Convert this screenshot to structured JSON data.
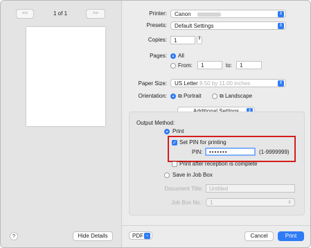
{
  "preview": {
    "page_counter": "1 of 1",
    "prev_label": "<<",
    "prev_single_label": "<",
    "next_single_label": ">",
    "next_label": ">>",
    "help_label": "?",
    "hide_details_label": "Hide Details"
  },
  "printer": {
    "label": "Printer:",
    "value": "Canon"
  },
  "presets": {
    "label": "Presets:",
    "value": "Default Settings"
  },
  "copies": {
    "label": "Copies:",
    "value": "1"
  },
  "pages": {
    "label": "Pages:",
    "all_label": "All",
    "from_label": "From:",
    "from_value": "1",
    "to_label": "to:",
    "to_value": "1"
  },
  "paper_size": {
    "label": "Paper Size:",
    "value": "US Letter",
    "detail": "8.50 by 11.00 inches"
  },
  "orientation": {
    "label": "Orientation:",
    "portrait_label": "Portrait",
    "landscape_label": "Landscape"
  },
  "section_popup": {
    "value": "Additional Settings"
  },
  "output": {
    "label": "Output Method:",
    "print_label": "Print",
    "set_pin_label": "Set PIN for printing",
    "pin_label": "PIN:",
    "pin_value": "•••••••",
    "pin_range": "(1-9999999)",
    "after_reception_label": "Print after reception is complete",
    "save_job_box_label": "Save in Job Box",
    "doc_title_label": "Document Title:",
    "doc_title_value": "Untitled",
    "job_box_label": "Job Box No.:",
    "job_box_value": "1"
  },
  "footer": {
    "pdf_label": "PDF",
    "cancel_label": "Cancel",
    "print_label": "Print"
  },
  "colors": {
    "accent": "#2f7bf5",
    "highlight": "#d51c1c"
  }
}
